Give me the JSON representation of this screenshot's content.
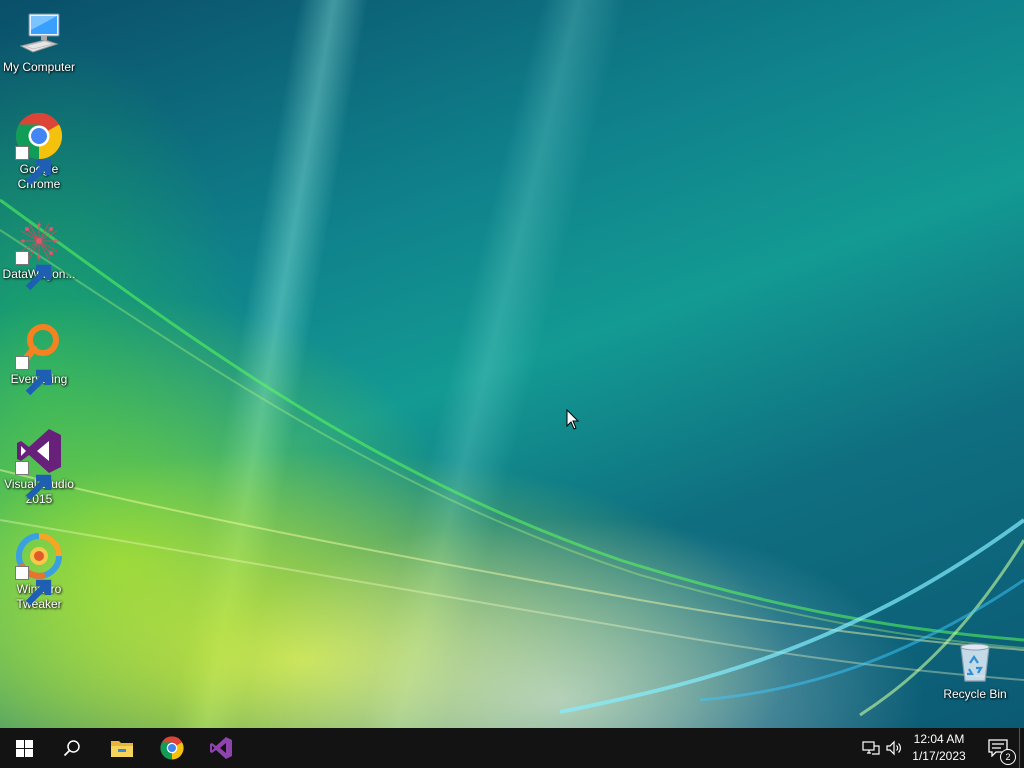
{
  "desktop": {
    "icons": [
      {
        "label_lines": [
          "My Computer"
        ],
        "icon": "computer-icon",
        "shortcut": false
      },
      {
        "label_lines": [
          "Google",
          "Chrome"
        ],
        "icon": "chrome-icon",
        "shortcut": true
      },
      {
        "label_lines": [
          "DataWagon..."
        ],
        "icon": "datawagon-icon",
        "shortcut": true
      },
      {
        "label_lines": [
          "Everything"
        ],
        "icon": "everything-search-icon",
        "shortcut": true
      },
      {
        "label_lines": [
          "Visual Studio",
          "2015"
        ],
        "icon": "visual-studio-icon",
        "shortcut": true
      },
      {
        "label_lines": [
          "Winaero",
          "Tweaker"
        ],
        "icon": "winaero-tweaker-icon",
        "shortcut": true
      }
    ],
    "recycle_bin": {
      "label": "Recycle Bin",
      "icon": "recycle-bin-icon"
    }
  },
  "taskbar": {
    "start_icon": "windows-logo-icon",
    "search_icon": "search-icon",
    "pinned": [
      "file-explorer-icon",
      "chrome-icon",
      "visual-studio-icon"
    ],
    "tray": {
      "network_icon": "network-icon",
      "volume_icon": "volume-icon",
      "time": "12:04 AM",
      "date": "1/17/2023",
      "notification_count": "2"
    }
  },
  "colors": {
    "taskbar_bg": "#131313",
    "chrome_red": "#db4437",
    "chrome_yellow": "#f4c20d",
    "chrome_green": "#0f9d58",
    "chrome_blue": "#4285f4",
    "vs_purple": "#68217a",
    "everything_orange": "#f58220"
  }
}
